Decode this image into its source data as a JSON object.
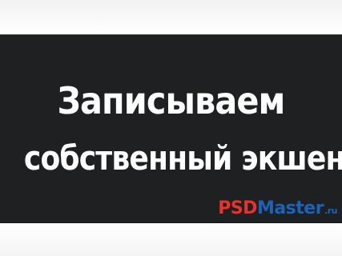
{
  "banner": {
    "title_line_1": "Записываем",
    "title_line_2": "собственный экшен",
    "background_color": "#1f2022",
    "text_color": "#ffffff"
  },
  "logo": {
    "part_psd": "PSD",
    "part_master": "Master",
    "part_tld": ".ru",
    "color_psd": "#e8322b",
    "color_master": "#1a63b8"
  }
}
